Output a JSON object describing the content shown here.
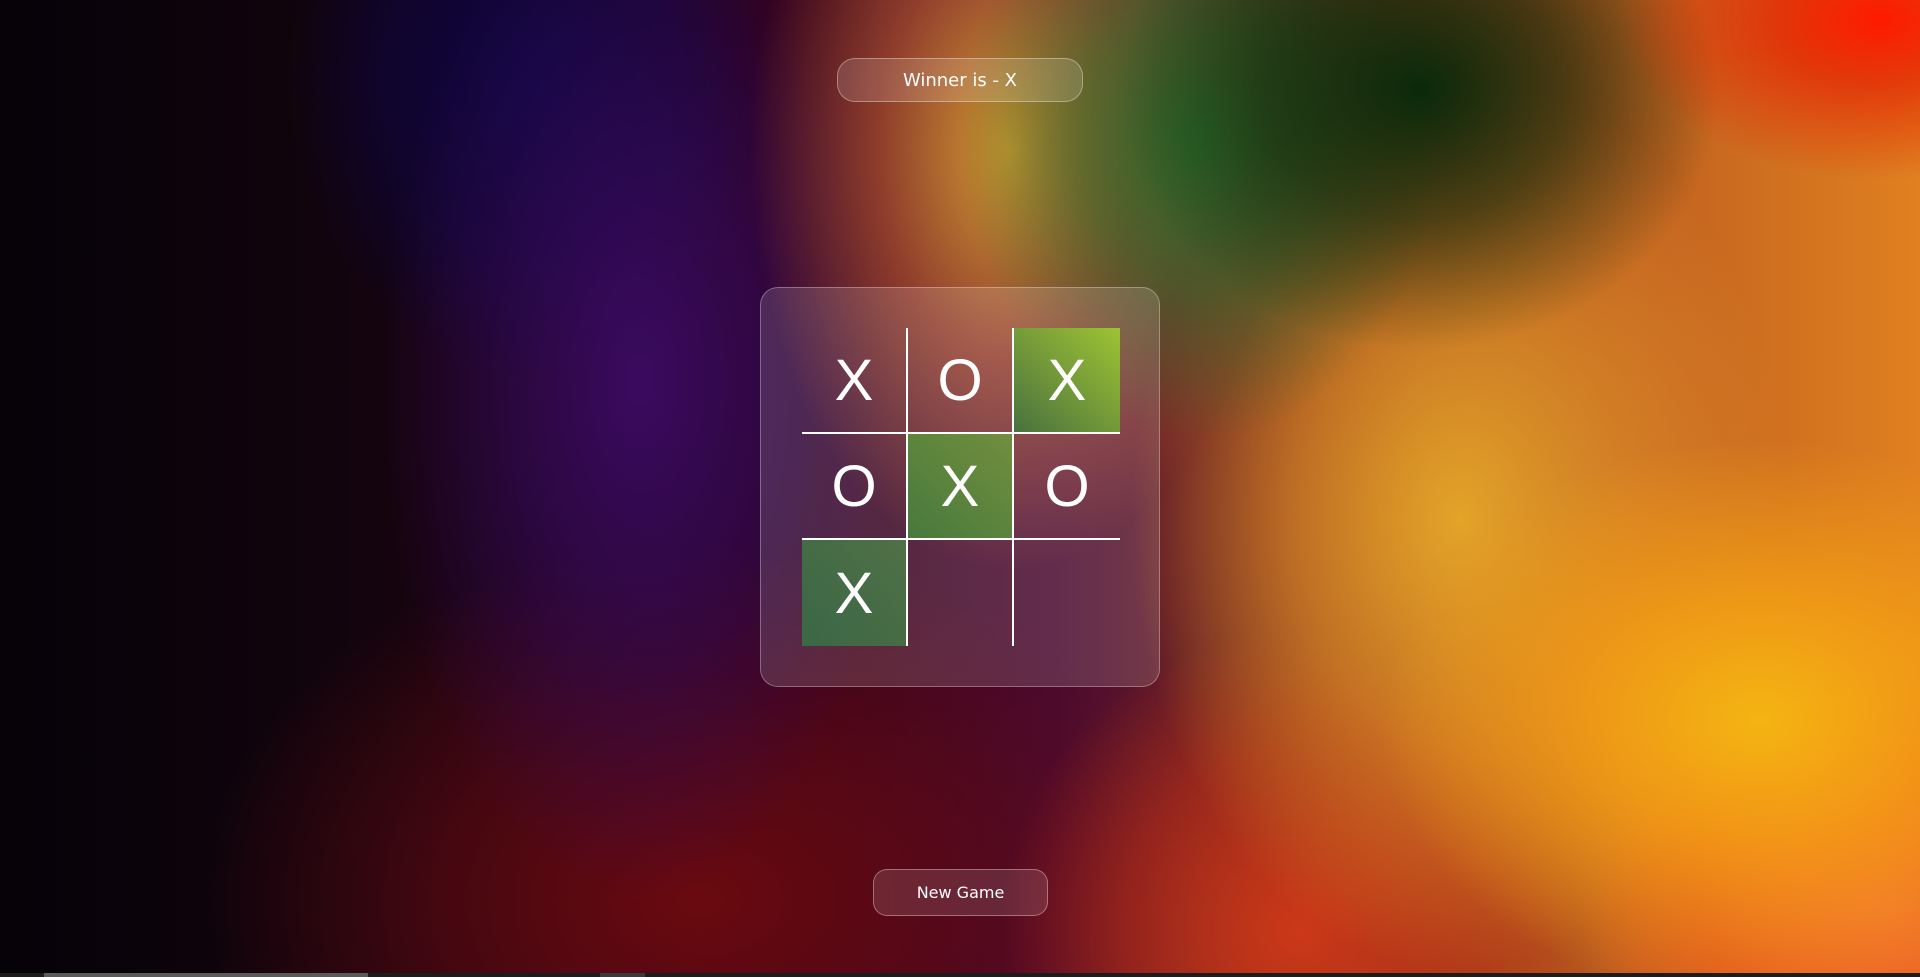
{
  "status": {
    "text": "Winner is - X"
  },
  "board": {
    "cells": [
      "X",
      "O",
      "X",
      "O",
      "X",
      "O",
      "X",
      "",
      ""
    ],
    "winning_cells": [
      2,
      4,
      6
    ],
    "win_color": "#5a8a40"
  },
  "new_game": {
    "label": "New Game"
  }
}
